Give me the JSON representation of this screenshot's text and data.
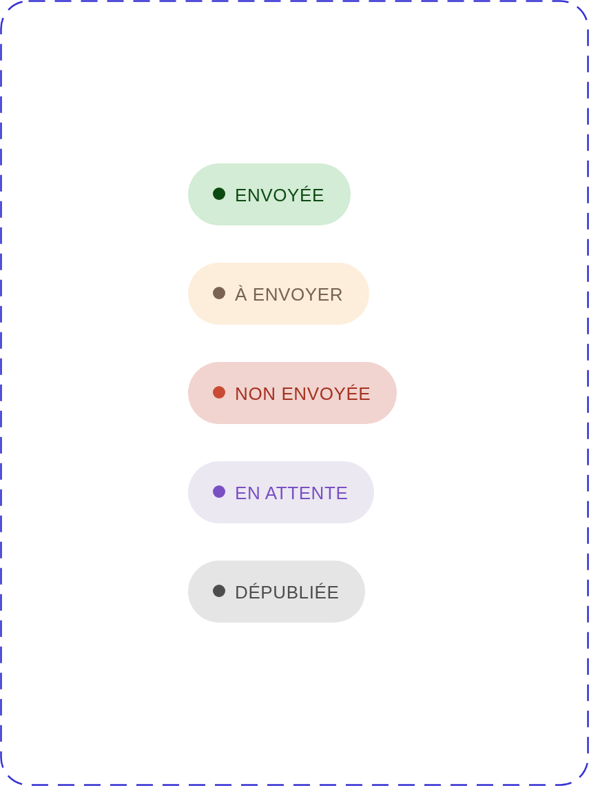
{
  "badges": [
    {
      "kind": "sent",
      "label": "ENVOYÉE",
      "color": "#0d4a12"
    },
    {
      "kind": "to_send",
      "label": "À ENVOYER",
      "color": "#7a6451"
    },
    {
      "kind": "not_sent",
      "label": "NON ENVOYÉE",
      "color": "#c94b33"
    },
    {
      "kind": "pending",
      "label": "EN ATTENTE",
      "color": "#7a4fc3"
    },
    {
      "kind": "unpublished",
      "label": "DÉPUBLIÉE",
      "color": "#4d4d4d"
    }
  ]
}
